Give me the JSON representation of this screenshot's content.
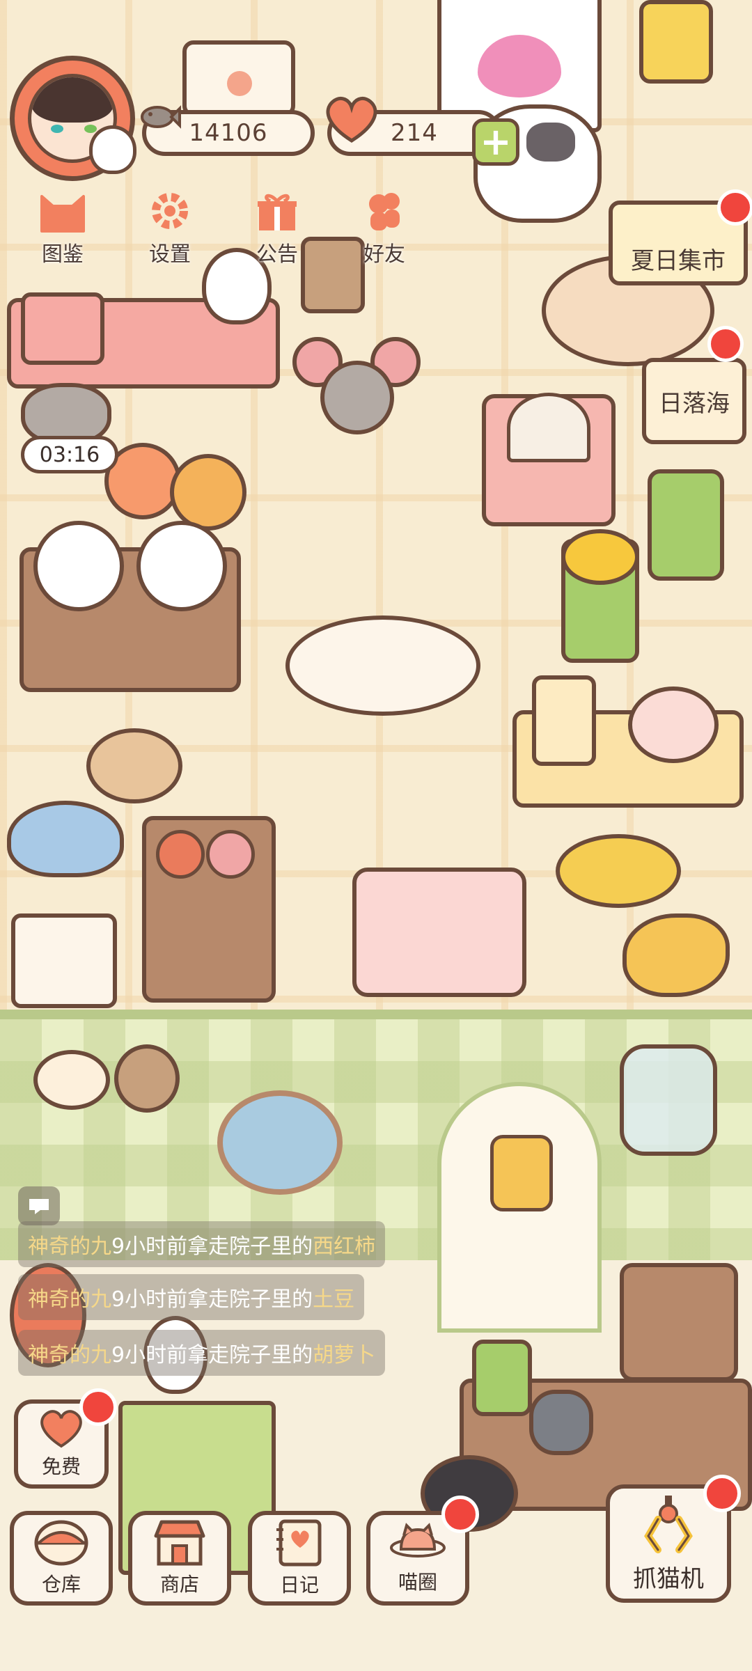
{
  "currency": {
    "fish_count": "14106",
    "heart_count": "214"
  },
  "menu": [
    {
      "label": "图鉴",
      "icon": "cat-head-icon"
    },
    {
      "label": "设置",
      "icon": "gear-icon"
    },
    {
      "label": "公告",
      "icon": "gift-icon"
    },
    {
      "label": "好友",
      "icon": "friends-icon"
    }
  ],
  "events": [
    {
      "label": "夏日集市"
    },
    {
      "label": "日落海"
    }
  ],
  "timer": "03:16",
  "log": [
    {
      "name": "神奇的九",
      "text": "9小时前拿走院子里的",
      "item": "西红柿"
    },
    {
      "name": "神奇的九",
      "text": "9小时前拿走院子里的",
      "item": "土豆"
    },
    {
      "name": "神奇的九",
      "text": "9小时前拿走院子里的",
      "item": "胡萝卜"
    }
  ],
  "buttons": {
    "free": "免费",
    "warehouse": "仓库",
    "shop": "商店",
    "diary": "日记",
    "cat_circle": "喵圈",
    "claw_machine": "抓猫机"
  },
  "colors": {
    "outline": "#6b4a3a",
    "coral": "#f2805f",
    "badge_red": "#f0453d",
    "floor": "#f8ecd2",
    "wall_green": "#e9efc6"
  }
}
